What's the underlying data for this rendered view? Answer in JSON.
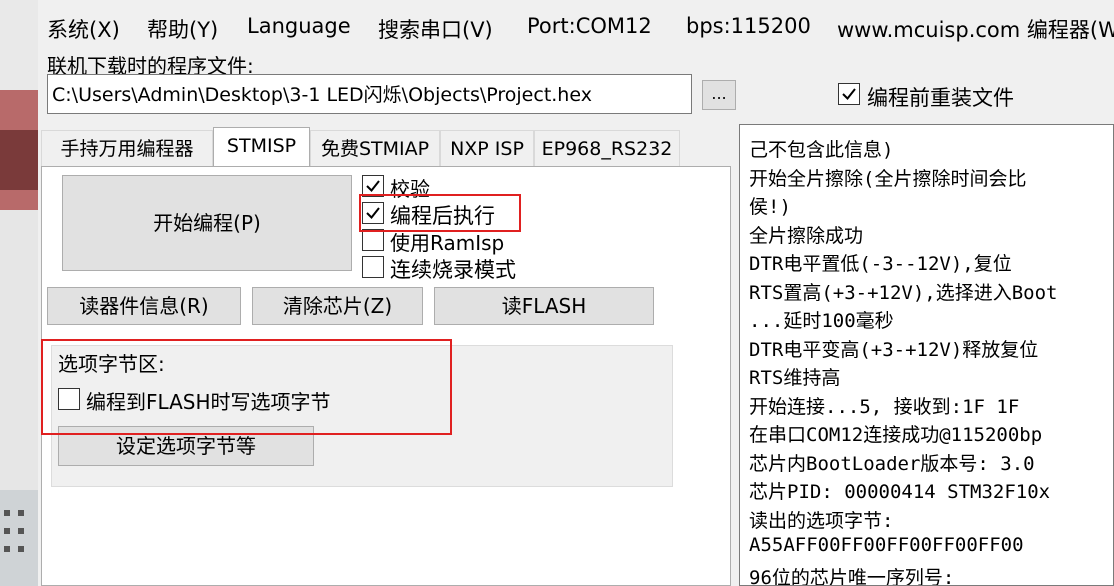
{
  "menu": [
    "系统(X)",
    "帮助(Y)",
    "Language",
    "搜索串口(V)",
    "Port:COM12",
    "bps:115200",
    "www.mcuisp.com 编程器(W"
  ],
  "file_section": {
    "label": "联机下载时的程序文件:",
    "path": "C:\\Users\\Admin\\Desktop\\3-1 LED闪烁\\Objects\\Project.hex",
    "browse_label": "...",
    "reload_label": "编程前重装文件",
    "reload_checked": true
  },
  "tabs": [
    {
      "label": "手持万用编程器",
      "active": false
    },
    {
      "label": "STMISP",
      "active": true
    },
    {
      "label": "免费STMIAP",
      "active": false
    },
    {
      "label": "NXP ISP",
      "active": false
    },
    {
      "label": "EP968_RS232",
      "active": false
    }
  ],
  "stmisp": {
    "start_button": "开始编程(P)",
    "options": [
      {
        "label": "校验",
        "checked": true
      },
      {
        "label": "编程后执行",
        "checked": true
      },
      {
        "label": "使用RamIsp",
        "checked": false
      },
      {
        "label": "连续烧录模式",
        "checked": false
      }
    ],
    "read_info_button": "读器件信息(R)",
    "erase_button": "清除芯片(Z)",
    "read_flash_button": "读FLASH",
    "option_group": {
      "title": "选项字节区:",
      "write_option_label": "编程到FLASH时写选项字节",
      "write_option_checked": false,
      "set_button": "设定选项字节等"
    }
  },
  "log_lines": [
    "己不包含此信息)",
    "开始全片擦除(全片擦除时间会比",
    "侯!)",
    "全片擦除成功",
    "DTR电平置低(-3--12V),复位",
    "RTS置高(+3-+12V),选择进入Boot",
    "...延时100毫秒",
    "DTR电平变高(+3-+12V)释放复位",
    "RTS维持高",
    "开始连接...5, 接收到:1F 1F",
    "在串口COM12连接成功@115200bp",
    "芯片内BootLoader版本号: 3.0",
    "芯片PID: 00000414  STM32F10x",
    "读出的选项字节:",
    "A55AFF00FF00FF00FF00FF00",
    "96位的芯片唯一序列号:"
  ],
  "colors": {
    "highlight": "#e02020"
  }
}
